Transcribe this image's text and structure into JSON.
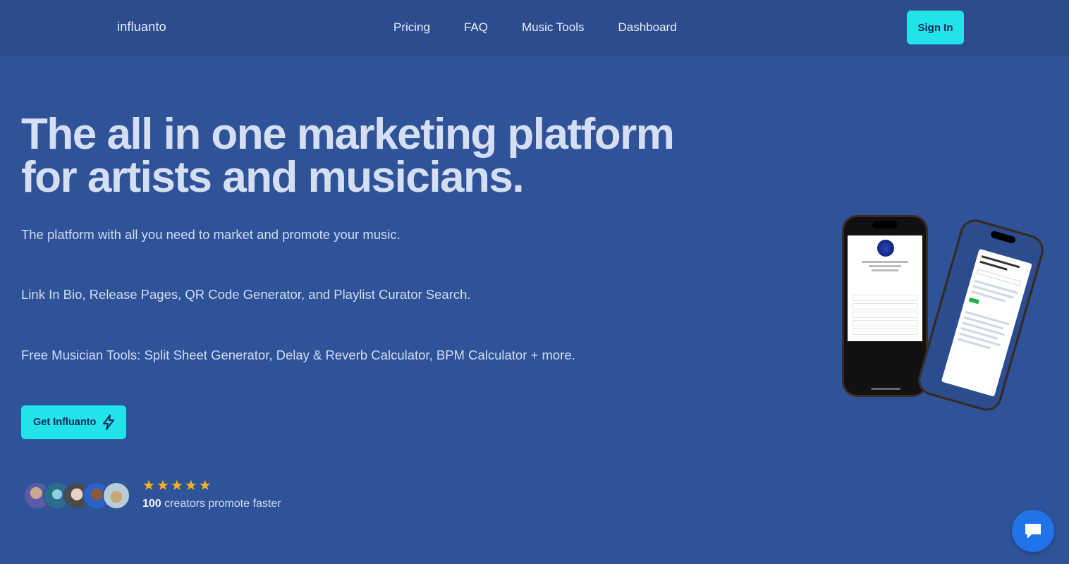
{
  "nav": {
    "logo": "influanto",
    "links": [
      "Pricing",
      "FAQ",
      "Music Tools",
      "Dashboard"
    ],
    "sign_in": "Sign In"
  },
  "hero": {
    "headline_line1": "The all in one marketing platform",
    "headline_line2": "for artists and musicians.",
    "sub1": "The platform with all you need to market and promote your music.",
    "sub2": "Link In Bio, Release Pages, QR Code Generator, and Playlist Curator Search.",
    "sub3": "Free Musician Tools: Split Sheet Generator, Delay & Reverb Calculator, BPM Calculator + more.",
    "cta": "Get Influanto"
  },
  "social_proof": {
    "rating": 5,
    "count": "100",
    "text": "creators promote faster"
  },
  "colors": {
    "background": "#2f5399",
    "nav": "#2b4d8f",
    "accent": "#22e2ea",
    "star": "#f6b21d",
    "chat": "#1e74e8"
  },
  "icons": {
    "cta": "lightning-bolt-icon",
    "chat": "chat-bubble-icon",
    "star": "star-icon"
  }
}
